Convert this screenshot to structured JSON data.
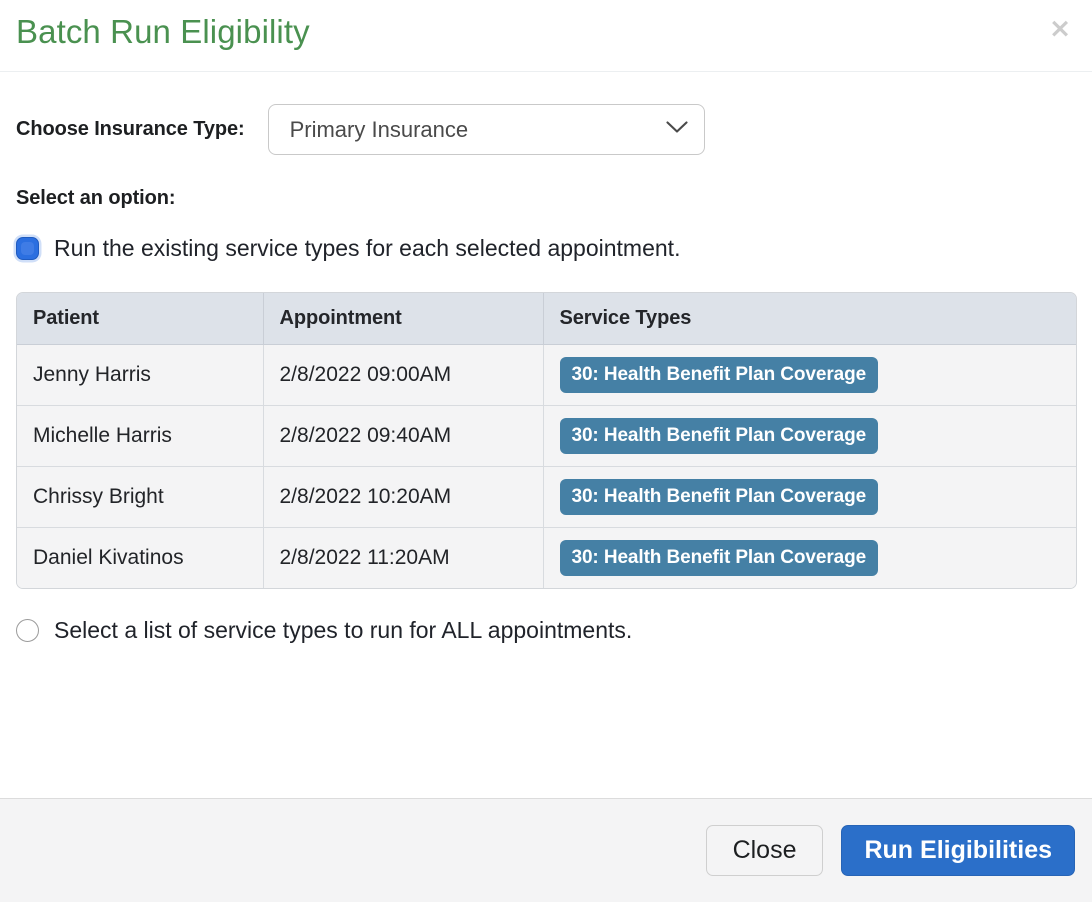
{
  "dialog": {
    "title": "Batch Run Eligibility",
    "close_icon": "close-icon",
    "close_label": "×"
  },
  "insurance": {
    "label": "Choose Insurance Type:",
    "selected": "Primary Insurance",
    "chevron_icon": "chevron-down-icon",
    "options": [
      "Primary Insurance"
    ]
  },
  "options_section": {
    "label": "Select an option:",
    "option1": {
      "label": "Run the existing service types for each selected appointment.",
      "selected": true
    },
    "option2": {
      "label": "Select a list of service types to run for ALL appointments.",
      "selected": false
    }
  },
  "table": {
    "columns": [
      "Patient",
      "Appointment",
      "Service Types"
    ],
    "rows": [
      {
        "patient": "Jenny Harris",
        "appointment": "2/8/2022 09:00AM",
        "service_type": "30: Health Benefit Plan Coverage"
      },
      {
        "patient": "Michelle Harris",
        "appointment": "2/8/2022 09:40AM",
        "service_type": "30: Health Benefit Plan Coverage"
      },
      {
        "patient": "Chrissy Bright",
        "appointment": "2/8/2022 10:20AM",
        "service_type": "30: Health Benefit Plan Coverage"
      },
      {
        "patient": "Daniel Kivatinos",
        "appointment": "2/8/2022 11:20AM",
        "service_type": "30: Health Benefit Plan Coverage"
      }
    ]
  },
  "footer": {
    "close_button": "Close",
    "run_button": "Run Eligibilities"
  },
  "colors": {
    "title_green": "#4a9150",
    "badge_blue": "#4580a5",
    "primary_blue": "#2b6fc9",
    "radio_blue": "#2b6fe0",
    "header_row": "#dde2e9"
  }
}
